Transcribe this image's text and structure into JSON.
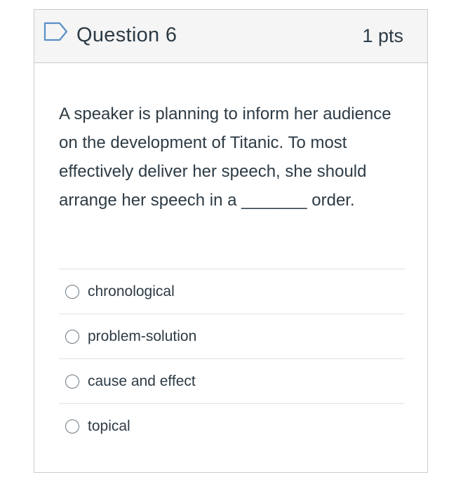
{
  "question": {
    "title": "Question 6",
    "points": "1 pts",
    "text": "A speaker is planning to inform her audience on the development of Titanic. To most effectively deliver her speech, she should arrange her speech in a _______ order.",
    "flag_icon": "flag-outline-icon"
  },
  "answers": [
    {
      "label": "chronological",
      "selected": false
    },
    {
      "label": "problem-solution",
      "selected": false
    },
    {
      "label": "cause and effect",
      "selected": false
    },
    {
      "label": "topical",
      "selected": false
    }
  ],
  "colors": {
    "text": "#2d3b45",
    "header_bg": "#f5f5f5",
    "border": "#c7cdd1",
    "flag": "#5a8fc7"
  }
}
